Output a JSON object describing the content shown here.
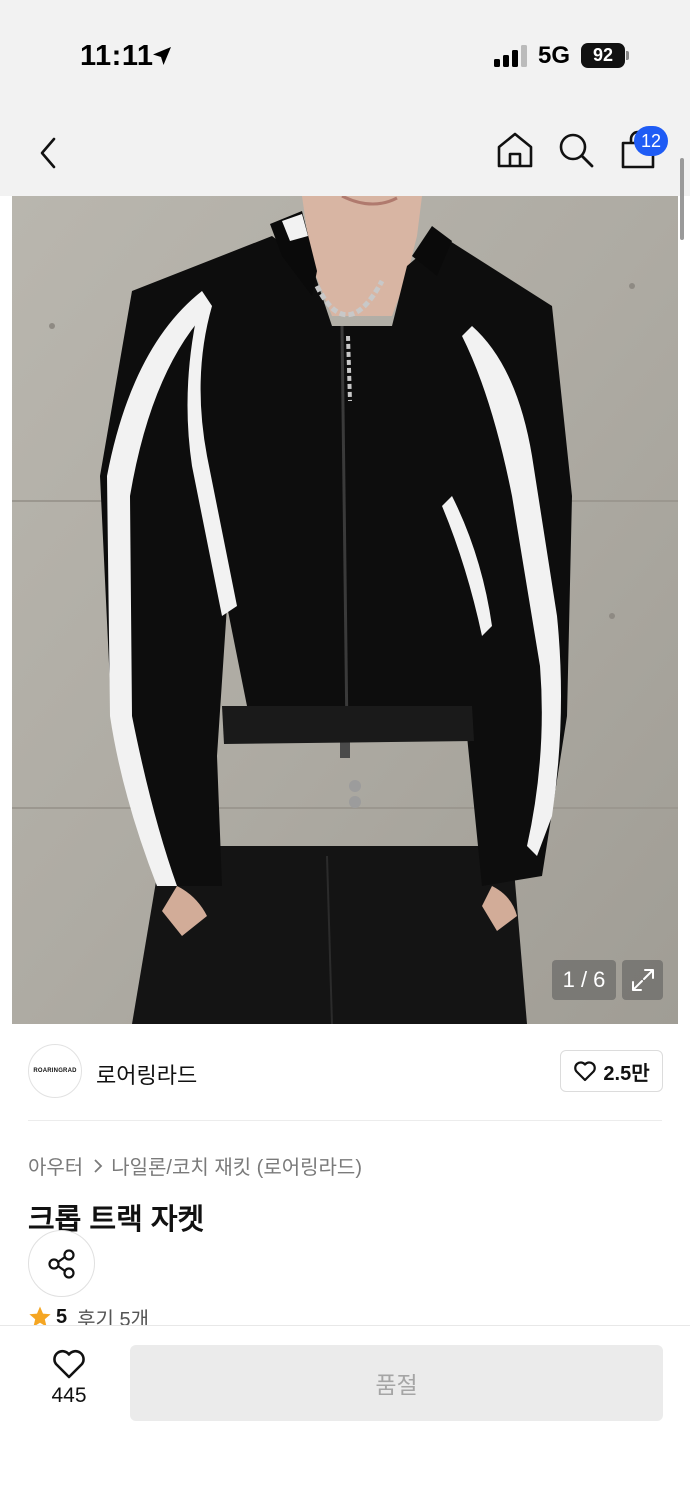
{
  "status_bar": {
    "time": "11:11",
    "network": "5G",
    "battery": "92"
  },
  "nav": {
    "cart_count": "12",
    "icons": [
      "back-icon",
      "home-icon",
      "search-icon",
      "shopping-bag-icon"
    ]
  },
  "gallery": {
    "counter": "1 / 6"
  },
  "brand": {
    "logo_text": "ROARINGRAD",
    "name": "로어링라드",
    "likes": "2.5만"
  },
  "breadcrumb": {
    "category": "아우터",
    "subcategory": "나일론/코치 재킷 (로어링라드)"
  },
  "product": {
    "title": "크롭 트랙 자켓",
    "rating": "5",
    "reviews": "후기 5개"
  },
  "bottom_bar": {
    "wish_count": "445",
    "buy_label": "품절"
  },
  "colors": {
    "badge": "#1f5cf5",
    "star": "#f5a623",
    "soldout_bg": "#ebebeb"
  }
}
